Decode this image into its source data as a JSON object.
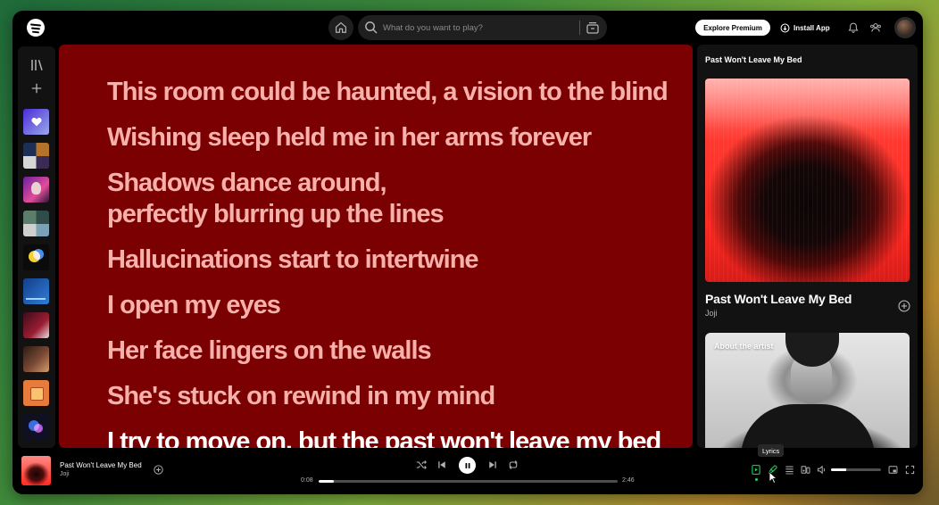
{
  "header": {
    "search_placeholder": "What do you want to play?",
    "premium_label": "Explore Premium",
    "install_label": "Install App"
  },
  "lyrics": [
    "This room could be haunted, a vision to the blind",
    "Wishing sleep held me in her arms forever",
    "Shadows dance around,",
    "perfectly blurring up the lines",
    "Hallucinations start to intertwine",
    "I open my eyes",
    "Her face lingers on the walls",
    "She's stuck on rewind in my mind",
    "I try to move on, but the past won't leave my bed"
  ],
  "right_panel": {
    "title": "Past Won't Leave My Bed",
    "track_title": "Past Won't Leave My Bed",
    "artist": "Joji",
    "about_label": "About the artist"
  },
  "player": {
    "track_title": "Past Won't Leave My Bed",
    "artist": "Joji",
    "elapsed": "0:08",
    "duration": "2:46",
    "progress": 0.05,
    "volume": 0.3,
    "tooltip": "Lyrics"
  },
  "colors": {
    "lyrics_bg": "#7b0002",
    "lyric_text": "#f7b0aa",
    "accent_green": "#1ed760"
  }
}
